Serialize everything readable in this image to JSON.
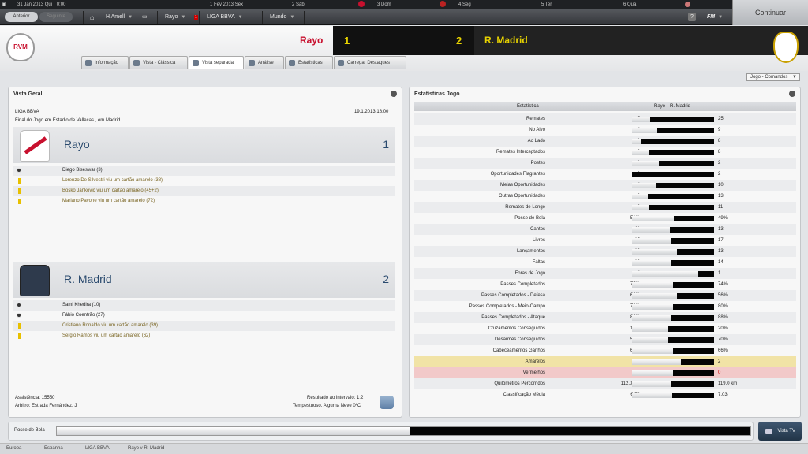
{
  "calendar": {
    "current_date": "31 Jan 2013",
    "current_day": "Qui",
    "current_time": "0:00",
    "days": [
      {
        "date": "1 Fev 2013",
        "day": "Sex"
      },
      {
        "date": "2",
        "day": "Sáb"
      },
      {
        "date": "3",
        "day": "Dom"
      },
      {
        "date": "4",
        "day": "Seg"
      },
      {
        "date": "5",
        "day": "Ter"
      },
      {
        "date": "6",
        "day": "Qua"
      }
    ]
  },
  "nav": {
    "back": "Anterior",
    "forward": "Seguinte",
    "manager": "H Amell",
    "club": "Rayo",
    "league": "LIGA BBVA",
    "world": "Mundo",
    "fm": "FM",
    "continue": "Continuar"
  },
  "match": {
    "home": "Rayo",
    "away": "R. Madrid",
    "home_score": "1",
    "away_score": "2"
  },
  "tabs": [
    "Informação",
    "Vista - Clássica",
    "Vista separada",
    "Análise",
    "Estatísticas",
    "Carregar Destaques"
  ],
  "dropdown": "Jogo - Comandos",
  "overview": {
    "title": "Vista Geral",
    "competition": "LIGA BBVA",
    "date": "19.1.2013 18:00",
    "venue": "Final do Jogo em Estadio de Vallecas , em Madrid",
    "home": {
      "name": "Rayo",
      "score": "1",
      "events": [
        {
          "type": "goal",
          "text": "Diego Biseswar (3)"
        },
        {
          "type": "yellow",
          "text": "Lorenzo De Silvestri viu um cartão amarelo (38)"
        },
        {
          "type": "yellow",
          "text": "Bosko Jankovic viu um cartão amarelo (45+2)"
        },
        {
          "type": "yellow",
          "text": "Mariano Pavone viu um cartão amarelo (72)"
        }
      ]
    },
    "away": {
      "name": "R. Madrid",
      "score": "2",
      "events": [
        {
          "type": "goal",
          "text": "Sami Khedira (10)"
        },
        {
          "type": "goal",
          "text": "Fábio Coentrão (27)"
        },
        {
          "type": "yellow",
          "text": "Cristiano Ronaldo viu um cartão amarelo (39)"
        },
        {
          "type": "yellow",
          "text": "Sergio Ramos viu um cartão amarelo (62)"
        }
      ]
    },
    "attendance": "Assistência: 15550",
    "referee": "Arbitro: Estrada Fernández, J",
    "halftime": "Resultado ao intervalo: 1:2",
    "weather": "Tempestuoso, Alguma Neve 0ºC"
  },
  "stats": {
    "title": "Estatísticas Jogo",
    "col_stat": "Estatística",
    "col_home": "Rayo",
    "col_away": "R. Madrid",
    "rows": [
      {
        "label": "Remates",
        "home": "7",
        "away": "25",
        "hf": 0.22
      },
      {
        "label": "No Alvo",
        "home": "4",
        "away": "9",
        "hf": 0.31
      },
      {
        "label": "Ao Lado",
        "home": "1",
        "away": "8",
        "hf": 0.11
      },
      {
        "label": "Remates Interceptados",
        "home": "2",
        "away": "8",
        "hf": 0.2
      },
      {
        "label": "Postes",
        "home": "1",
        "away": "2",
        "hf": 0.33
      },
      {
        "label": "Oportunidades Flagrantes",
        "home": "0",
        "away": "2",
        "hf": 0
      },
      {
        "label": "Meias Oportunidades",
        "home": "4",
        "away": "10",
        "hf": 0.29
      },
      {
        "label": "Outras Oportunidades",
        "home": "3",
        "away": "13",
        "hf": 0.19
      },
      {
        "label": "Remates de Longe",
        "home": "3",
        "away": "11",
        "hf": 0.21
      },
      {
        "label": "Posse de Bola",
        "home": "51%",
        "away": "49%",
        "hf": 0.51
      },
      {
        "label": "Cantos",
        "home": "11",
        "away": "13",
        "hf": 0.46
      },
      {
        "label": "Livres",
        "home": "15",
        "away": "17",
        "hf": 0.47
      },
      {
        "label": "Lançamentos",
        "home": "16",
        "away": "13",
        "hf": 0.55
      },
      {
        "label": "Faltas",
        "home": "13",
        "away": "14",
        "hf": 0.48
      },
      {
        "label": "Foras de Jogo",
        "home": "4",
        "away": "1",
        "hf": 0.8
      },
      {
        "label": "Passes Completados",
        "home": "75%",
        "away": "74%",
        "hf": 0.5
      },
      {
        "label": "Passes Completados - Defesa",
        "home": "69%",
        "away": "56%",
        "hf": 0.55
      },
      {
        "label": "Passes Completados - Meio-Campo",
        "home": "79%",
        "away": "80%",
        "hf": 0.5
      },
      {
        "label": "Passes Completados - Ataque",
        "home": "82%",
        "away": "88%",
        "hf": 0.48
      },
      {
        "label": "Cruzamentos Conseguidos",
        "home": "16%",
        "away": "20%",
        "hf": 0.44
      },
      {
        "label": "Desarmes Conseguidos",
        "home": "52%",
        "away": "70%",
        "hf": 0.43
      },
      {
        "label": "Cabeceamentos Ganhos",
        "home": "67%",
        "away": "66%",
        "hf": 0.5
      },
      {
        "label": "Amarelos",
        "home": "3",
        "away": "2",
        "hf": 0.6,
        "hl": "#f1e3a6"
      },
      {
        "label": "Vermelhos",
        "home": "0",
        "away": "0",
        "hf": 0.5,
        "hl": "#f2c9c9",
        "red": true
      },
      {
        "label": "Quilómetros Percorridos",
        "home": "112.0 km",
        "away": "119.0 km",
        "hf": 0.48
      },
      {
        "label": "Classificação Média",
        "home": "6.78",
        "away": "7.03",
        "hf": 0.49
      }
    ]
  },
  "possession": {
    "label": "Posse de Bola",
    "home_fraction": 0.51
  },
  "tv_button": "Vista TV",
  "breadcrumb": [
    "Europa",
    "Espanha",
    "LIGA BBVA",
    "Rayo v R. Madrid"
  ],
  "colors": {
    "home": "#c8102e",
    "away": "#ffffff",
    "bar_dark": "#050505"
  }
}
